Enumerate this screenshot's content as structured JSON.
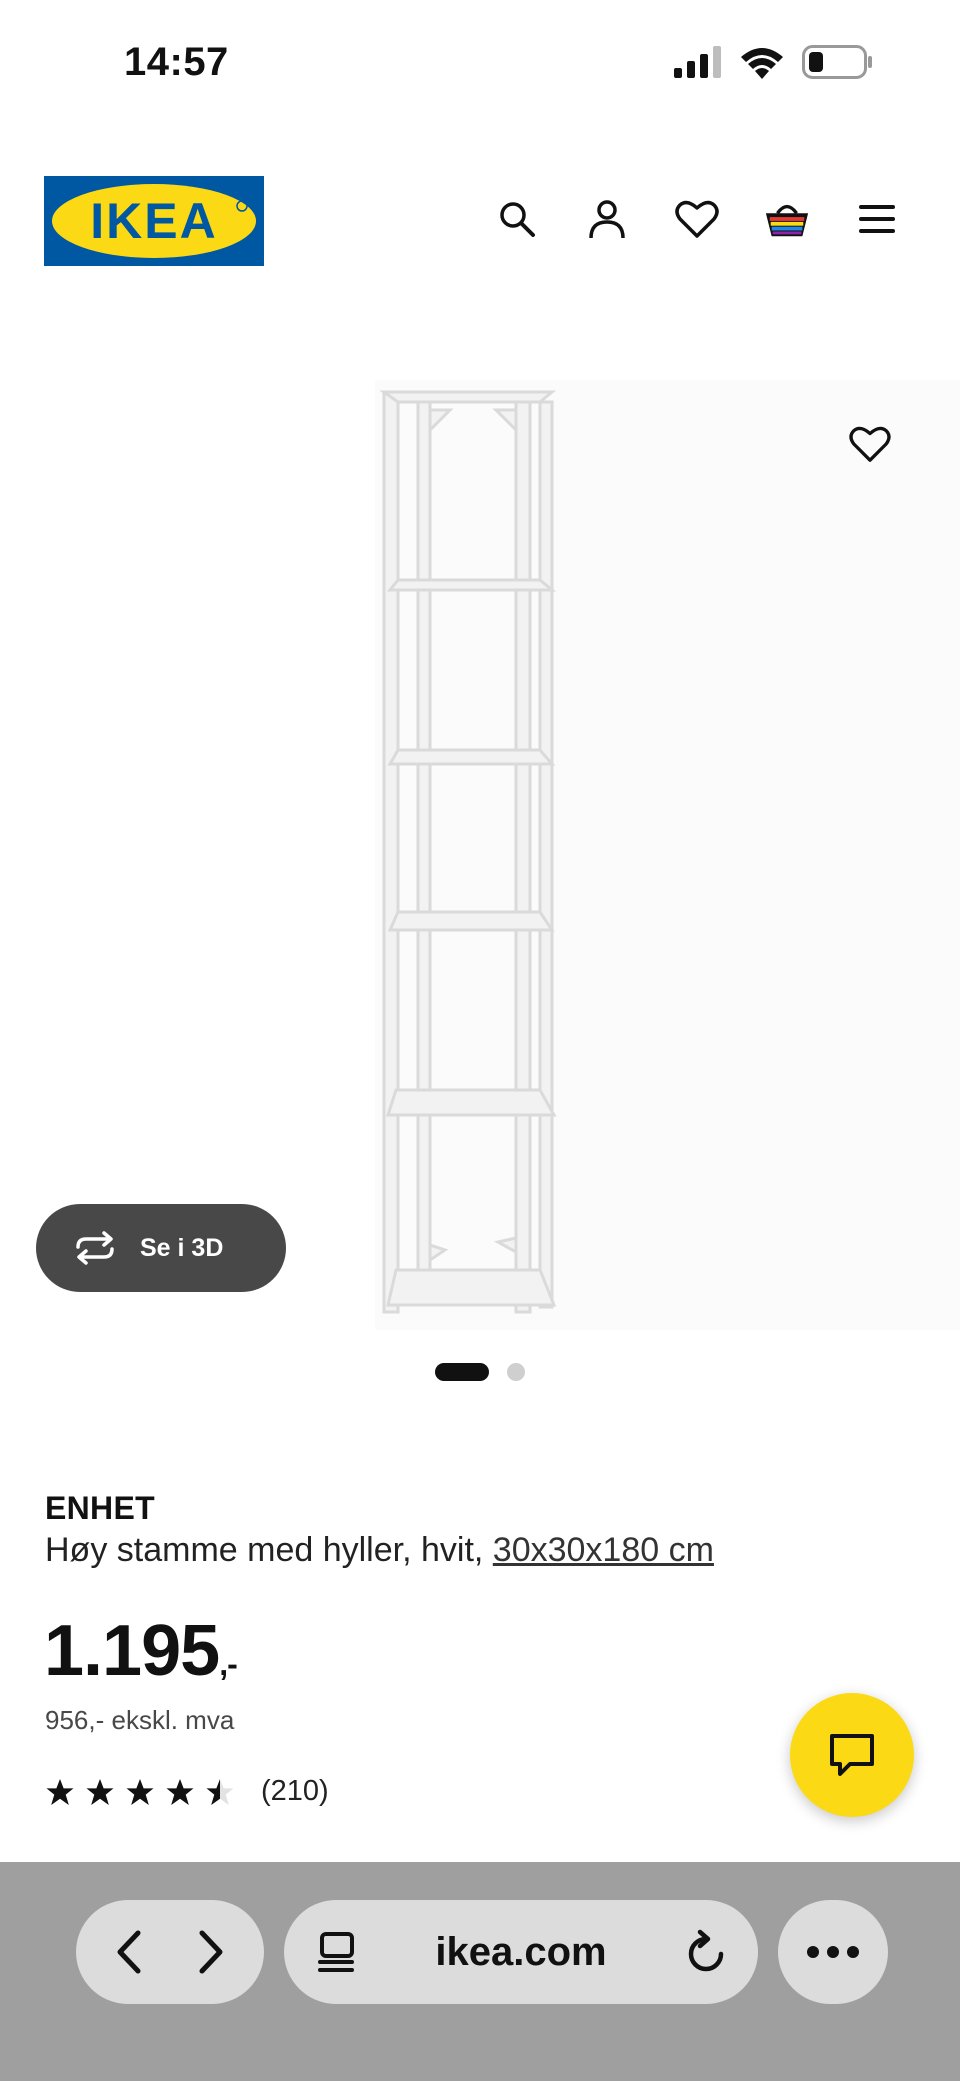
{
  "status_bar": {
    "time": "14:57"
  },
  "header": {
    "logo_text": "IKEA",
    "icons": [
      "search-icon",
      "account-icon",
      "heart-icon",
      "basket-icon",
      "menu-icon"
    ]
  },
  "gallery": {
    "view_3d_label": "Se i 3D",
    "page_count": 2,
    "active_page": 1
  },
  "product": {
    "name": "ENHET",
    "description": "Høy stamme med hyller, hvit,",
    "size": "30x30x180 cm",
    "price": "1.195",
    "price_suffix": ",-",
    "price_excl_vat": "956,- ekskl. mva",
    "rating": 4.5,
    "review_count": "(210)"
  },
  "browser": {
    "url": "ikea.com"
  },
  "colors": {
    "ikea_blue": "#0058a3",
    "ikea_yellow": "#fbd914",
    "dark_button": "#484848"
  }
}
